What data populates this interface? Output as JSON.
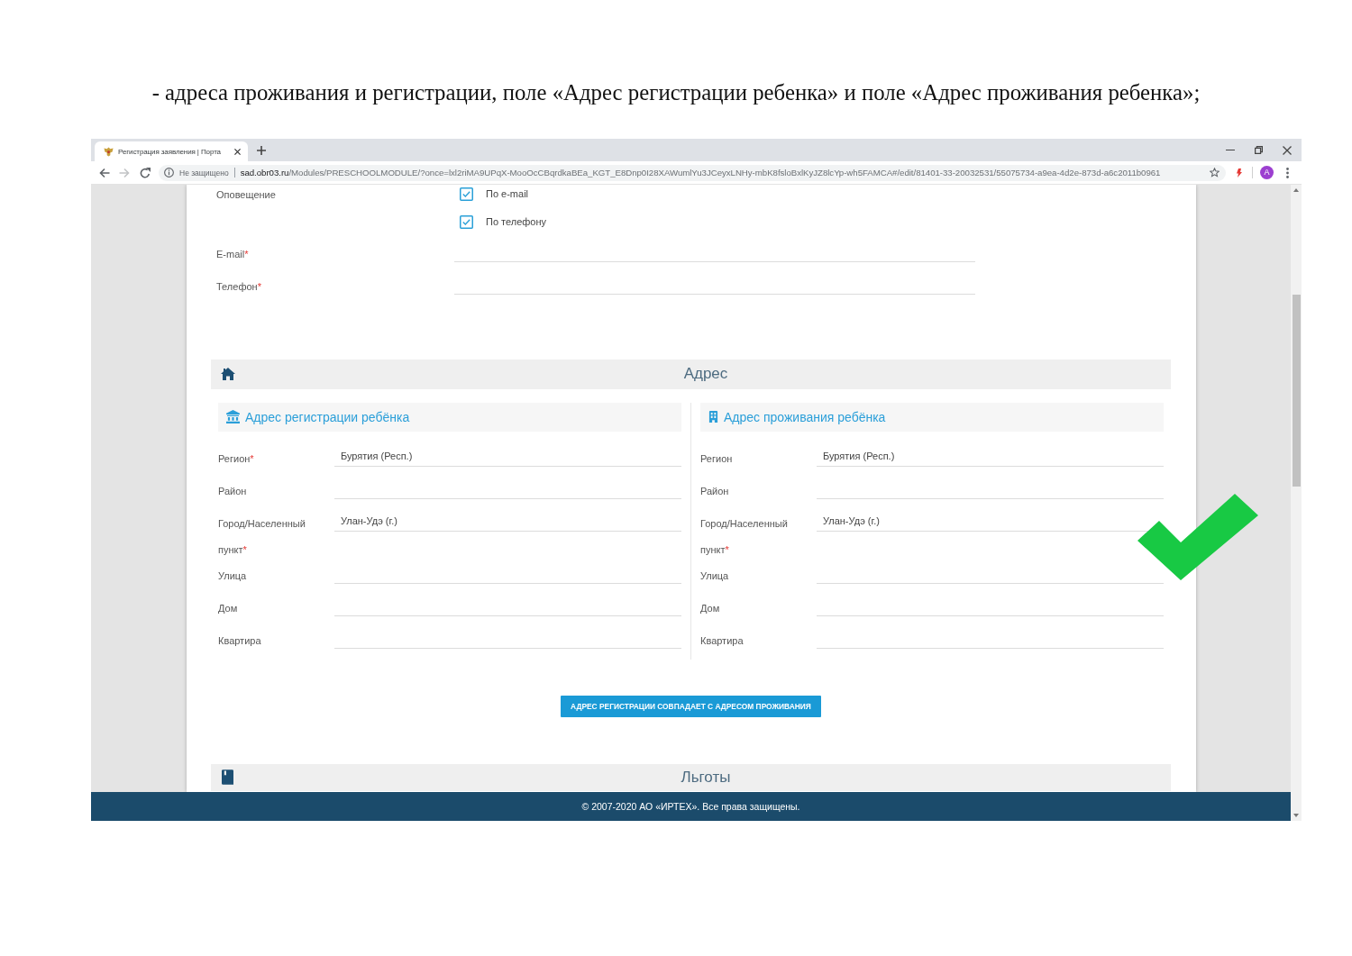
{
  "caption": "- адреса проживания и регистрации, поле «Адрес регистрации ребенка» и поле «Адрес проживания ребенка»;",
  "browser": {
    "tab_title": "Регистрация заявления | Порта",
    "security_label": "Не защищено",
    "url_host": "sad.obr03.ru",
    "url_path": "/Modules/PRESCHOOLMODULE/?once=lxl2riMA9UPqX-MooOcCBqrdkaBEa_KGT_E8Dnp0I28XAWumlYu3JCeyxLNHy-mbK8fsloBxlKyJZ8lcYp-wh5FAMCA#/edit/81401-33-20032531/55075734-a9ea-4d2e-873d-a6c2011b0961",
    "avatar_letter": "A"
  },
  "notification": {
    "label": "Оповещение",
    "options": [
      {
        "label": "По e-mail",
        "checked": true
      },
      {
        "label": "По телефону",
        "checked": true
      }
    ]
  },
  "contact_fields": [
    {
      "label": "E-mail",
      "required_mark": "*"
    },
    {
      "label": "Телефон",
      "required_mark": "*"
    }
  ],
  "address_section": {
    "title": "Адрес",
    "columns": [
      {
        "kind": "registration",
        "title": "Адрес регистрации ребёнка",
        "fields": [
          {
            "label": "Регион",
            "required_mark": "*",
            "value": "Бурятия (Респ.)"
          },
          {
            "label": "Район"
          },
          {
            "label": "Город/Населенный пункт",
            "required_mark": "*",
            "value": "Улан-Удэ (г.)"
          },
          {
            "label": "Улица"
          },
          {
            "label": "Дом"
          },
          {
            "label": "Квартира"
          }
        ]
      },
      {
        "kind": "residence",
        "title": "Адрес проживания ребёнка",
        "fields": [
          {
            "label": "Регион",
            "value": "Бурятия (Респ.)"
          },
          {
            "label": "Район"
          },
          {
            "label": "Город/Населенный пункт",
            "required_mark": "*",
            "value": "Улан-Удэ (г.)"
          },
          {
            "label": "Улица"
          },
          {
            "label": "Дом"
          },
          {
            "label": "Квартира"
          }
        ]
      }
    ],
    "same_address_button": "АДРЕС РЕГИСТРАЦИИ СОВПАДАЕТ С АДРЕСОМ ПРОЖИВАНИЯ"
  },
  "benefits_section": {
    "title": "Льготы"
  },
  "footer": "© 2007-2020 АО «ИРТЕХ». Все права защищены."
}
